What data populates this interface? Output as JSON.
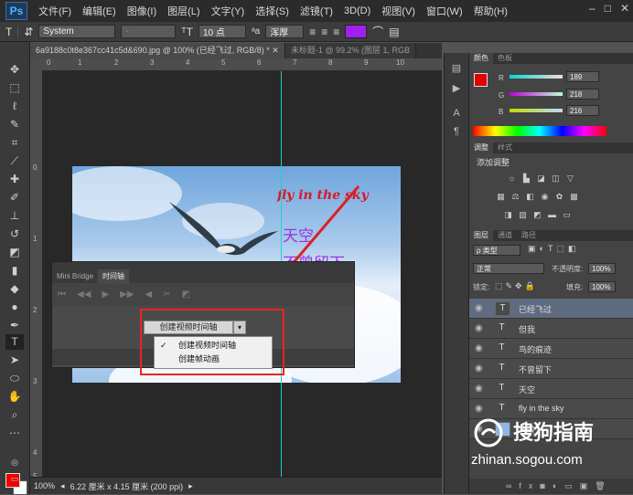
{
  "app": {
    "logo": "Ps"
  },
  "menu": [
    "文件(F)",
    "编辑(E)",
    "图像(I)",
    "图层(L)",
    "文字(Y)",
    "选择(S)",
    "滤镜(T)",
    "3D(D)",
    "视图(V)",
    "窗口(W)",
    "帮助(H)"
  ],
  "window_controls": [
    "–",
    "□",
    "✕"
  ],
  "options_bar": {
    "font_family": "System",
    "font_style": "-",
    "font_size": "10 点",
    "anti_alias": "浑厚",
    "text_color": "#a020f0"
  },
  "tabs": [
    {
      "label": "6a9188c0t8e367cc41c5d&690.jpg @ 100% (已经飞过, RGB/8) * ✕"
    },
    {
      "label": "未标题-1 @ 99.2% (图层 1, RGB"
    }
  ],
  "ruler_top": [
    "0",
    "1",
    "2",
    "3",
    "4",
    "5",
    "6",
    "7",
    "8",
    "9",
    "10"
  ],
  "ruler_left": [
    "0",
    "1",
    "2",
    "3",
    "4",
    "5"
  ],
  "canvas_text": {
    "fly": "fly in the sky",
    "sky": "天空",
    "line2": "不曾留下"
  },
  "timeline_panel": {
    "tabs": [
      "Mini Bridge",
      "时间轴"
    ],
    "create_button": "创建视频时间轴",
    "dropdown_arrow": "▾",
    "menu": [
      {
        "label": "创建视频时间轴",
        "checked": true
      },
      {
        "label": "创建帧动画",
        "checked": false
      }
    ]
  },
  "color_panel": {
    "tabs": [
      "颜色",
      "色板"
    ],
    "channels": [
      {
        "label": "R",
        "value": "189"
      },
      {
        "label": "G",
        "value": "218"
      },
      {
        "label": "B",
        "value": "216"
      }
    ],
    "foreground": "#e00000"
  },
  "adjust_panel": {
    "tabs": [
      "调整",
      "样式"
    ],
    "title": "添加调整"
  },
  "layers_panel": {
    "tabs": [
      "图层",
      "通道",
      "路径"
    ],
    "filter": "ρ 类型",
    "blend_mode": "正常",
    "opacity_label": "不透明度:",
    "opacity_value": "100%",
    "lock_label": "锁定:",
    "fill_label": "填充:",
    "fill_value": "100%",
    "layers": [
      {
        "name": "已经飞过",
        "selected": true
      },
      {
        "name": "但我",
        "selected": false
      },
      {
        "name": "鸟的痕迹",
        "selected": false
      },
      {
        "name": "不曾留下",
        "selected": false
      },
      {
        "name": "天空",
        "selected": false
      },
      {
        "name": "fly in the sky",
        "selected": false
      },
      {
        "name": "背景",
        "selected": false
      }
    ]
  },
  "status_bar": {
    "zoom": "100%",
    "doc_info": "6.22 厘米 x 4.15 厘米 (200 ppi)"
  },
  "watermark": {
    "brand": "搜狗指南",
    "url": "zhinan.sogou.com"
  }
}
